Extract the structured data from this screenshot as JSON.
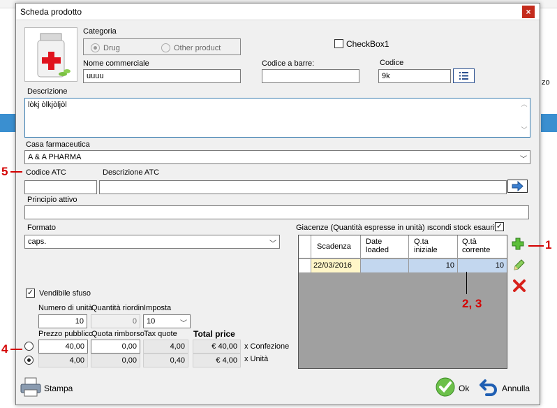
{
  "window": {
    "title": "Scheda prodotto",
    "close": "×"
  },
  "categoria": {
    "label": "Categoria",
    "options": [
      "Drug",
      "Other product"
    ],
    "selected": "Drug"
  },
  "checkbox1": {
    "label": "CheckBox1",
    "checked": false
  },
  "nome_commerciale": {
    "label": "Nome commerciale",
    "value": "uuuu"
  },
  "codice_barre": {
    "label": "Codice a barre:",
    "value": ""
  },
  "codice": {
    "label": "Codice",
    "value": "9k"
  },
  "descrizione": {
    "label": "Descrizione",
    "value": "lòkj òlkjòljòl"
  },
  "casa_farmaceutica": {
    "label": "Casa farmaceutica",
    "value": "A & A PHARMA"
  },
  "codice_atc": {
    "label": "Codice ATC",
    "value": ""
  },
  "descrizione_atc": {
    "label": "Descrizione ATC",
    "value": ""
  },
  "principio_attivo": {
    "label": "Principio attivo",
    "value": ""
  },
  "formato": {
    "label": "Formato",
    "value": "caps."
  },
  "giacenze": {
    "label": "Giacenze (Quantità espresse in unità) ıscondi stock esauriti",
    "hide_checked": true,
    "columns": [
      "Scadenza",
      "Date loaded",
      "Q.ta iniziale",
      "Q.tà corrente"
    ],
    "rows": [
      {
        "scadenza": "22/03/2016",
        "date_loaded": "",
        "iniziale": "10",
        "corrente": "10"
      }
    ]
  },
  "vendibile": {
    "label": "Vendibile sfuso",
    "checked": true
  },
  "numero_unita": {
    "label": "Numero di unità",
    "value": "10"
  },
  "quantita_riordino": {
    "label": "Quantità riordin",
    "value": "0"
  },
  "imposta": {
    "label": "Imposta",
    "value": "10"
  },
  "pricing": {
    "headers": {
      "prezzo": "Prezzo pubblicc",
      "quota": "Quota rimborso",
      "tax": "Tax quote",
      "total": "Total price"
    },
    "confezione": {
      "prezzo": "40,00",
      "quota": "0,00",
      "tax": "4,00",
      "total": "€ 40,00",
      "unit_label": "x Confezione"
    },
    "unita": {
      "prezzo": "4,00",
      "quota": "0,00",
      "tax": "0,40",
      "total": "€ 4,00",
      "unit_label": "x Unità"
    },
    "selected": "unita"
  },
  "buttons": {
    "stampa": "Stampa",
    "ok": "Ok",
    "annulla": "Annulla"
  },
  "annotations": {
    "a1": "1",
    "a23": "2, 3",
    "a4": "4",
    "a5": "5"
  },
  "background": {
    "zo": "zo"
  },
  "icons": [
    "pill-bottle-icon",
    "list-icon",
    "arrow-right-icon",
    "add-icon",
    "edit-icon",
    "delete-icon",
    "printer-icon",
    "ok-icon",
    "undo-icon"
  ]
}
